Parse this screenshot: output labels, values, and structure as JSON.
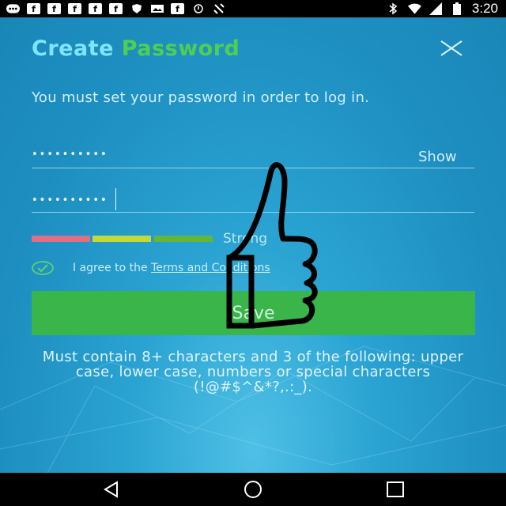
{
  "status_bar": {
    "time": "3:20",
    "left_icons": [
      "messenger-icon",
      "facebook-icon",
      "facebook-icon",
      "facebook-icon",
      "facebook-icon",
      "facebook-icon",
      "shield-icon",
      "photo-icon",
      "facebook-icon",
      "sync-icon",
      "satellite-icon"
    ],
    "right_icons": [
      "bluetooth-icon",
      "wifi-icon",
      "signal-icon",
      "battery-icon"
    ]
  },
  "header": {
    "title_part1": "Create",
    "title_part2": "Password"
  },
  "intro_text": "You must set your password in order to log in.",
  "password_field": {
    "dots": "••••••••••",
    "show_label": "Show"
  },
  "confirm_field": {
    "dots": "••••••••••"
  },
  "strength": {
    "label": "Strong",
    "colors": [
      "#e06f85",
      "#c3d938",
      "#64b63a"
    ]
  },
  "agree": {
    "prefix": "I agree to the ",
    "link": "Terms and Conditions",
    "checked": true
  },
  "save_button_label": "Save",
  "hint_text": "Must contain 8+ characters and 3 of the following: upper case, lower case, numbers or special characters (!@#$^&*?,.:_).",
  "colors": {
    "title_accent1": "#7fe5ff",
    "title_accent2": "#4fcf52",
    "save_bg": "#3ab54a",
    "background": "#1e8fc1"
  }
}
